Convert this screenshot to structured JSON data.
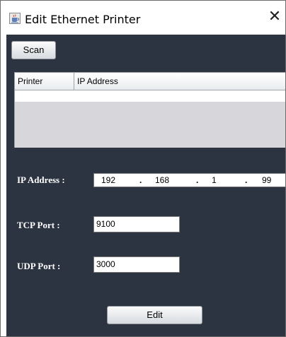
{
  "window": {
    "title": "Edit Ethernet Printer",
    "close_glyph": "✕",
    "app_icon": "java-cup-icon"
  },
  "toolbar": {
    "scan_label": "Scan"
  },
  "table": {
    "columns": [
      "Printer",
      "IP Address"
    ],
    "rows": []
  },
  "form": {
    "ip_label": "IP Address :",
    "ip_octets": [
      "192",
      "168",
      "1",
      "99"
    ],
    "ip_separator": ".",
    "tcp_label": "TCP Port :",
    "tcp_value": "9100",
    "udp_label": "UDP Port :",
    "udp_value": "3000"
  },
  "actions": {
    "edit_label": "Edit"
  }
}
